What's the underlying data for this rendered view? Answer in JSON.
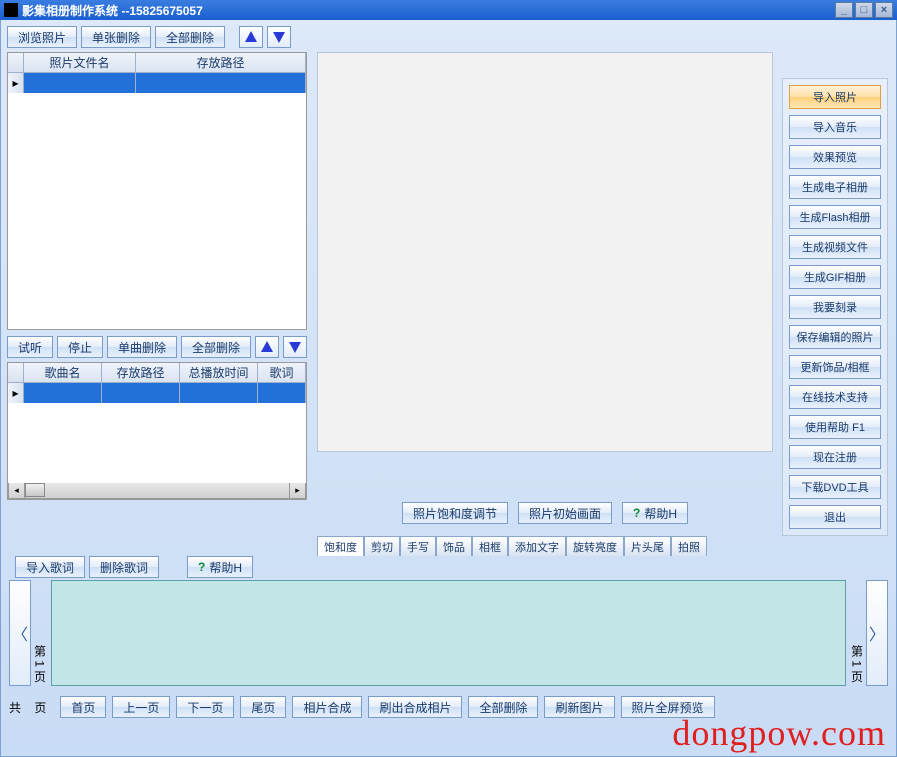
{
  "title": "影集相册制作系统  --15825675057",
  "window_buttons": {
    "min": "_",
    "max": "□",
    "close": "×"
  },
  "photo_toolbar": {
    "browse": "浏览照片",
    "delete_one": "单张删除",
    "delete_all": "全部删除"
  },
  "photo_grid": {
    "columns": [
      "照片文件名",
      "存放路径"
    ]
  },
  "song_toolbar": {
    "preview": "试听",
    "stop": "停止",
    "delete_one": "单曲删除",
    "delete_all": "全部删除"
  },
  "song_grid": {
    "columns": [
      "歌曲名",
      "存放路径",
      "总播放时间",
      "歌词"
    ]
  },
  "lyrics_toolbar": {
    "import": "导入歌词",
    "delete": "删除歌词",
    "help": "帮助H"
  },
  "preview_toolbar": {
    "saturation": "照片饱和度调节",
    "initial": "照片初始画面",
    "help": "帮助H"
  },
  "tabs": [
    "饱和度",
    "剪切",
    "手写",
    "饰品",
    "相框",
    "添加文字",
    "旋转亮度",
    "片头尾",
    "拍照"
  ],
  "right_buttons": [
    "导入照片",
    "导入音乐",
    "效果预览",
    "生成电子相册",
    "生成Flash相册",
    "生成视频文件",
    "生成GIF相册",
    "我要刻录",
    "保存编辑的照片",
    "更新饰品/相框",
    "在线技术支持",
    "使用帮助  F1",
    "现在注册",
    "下载DVD工具",
    "退出"
  ],
  "strip": {
    "page_left": "第 1 页",
    "page_right": "第 1 页"
  },
  "bottom": {
    "total_prefix": "共",
    "total_suffix": "页",
    "first": "首页",
    "prev": "上一页",
    "next": "下一页",
    "last": "尾页",
    "compose": "相片合成",
    "flush": "刷出合成相片",
    "delete_all": "全部删除",
    "refresh": "刷新图片",
    "fullscreen": "照片全屏预览"
  },
  "watermark": "dongpow.com"
}
